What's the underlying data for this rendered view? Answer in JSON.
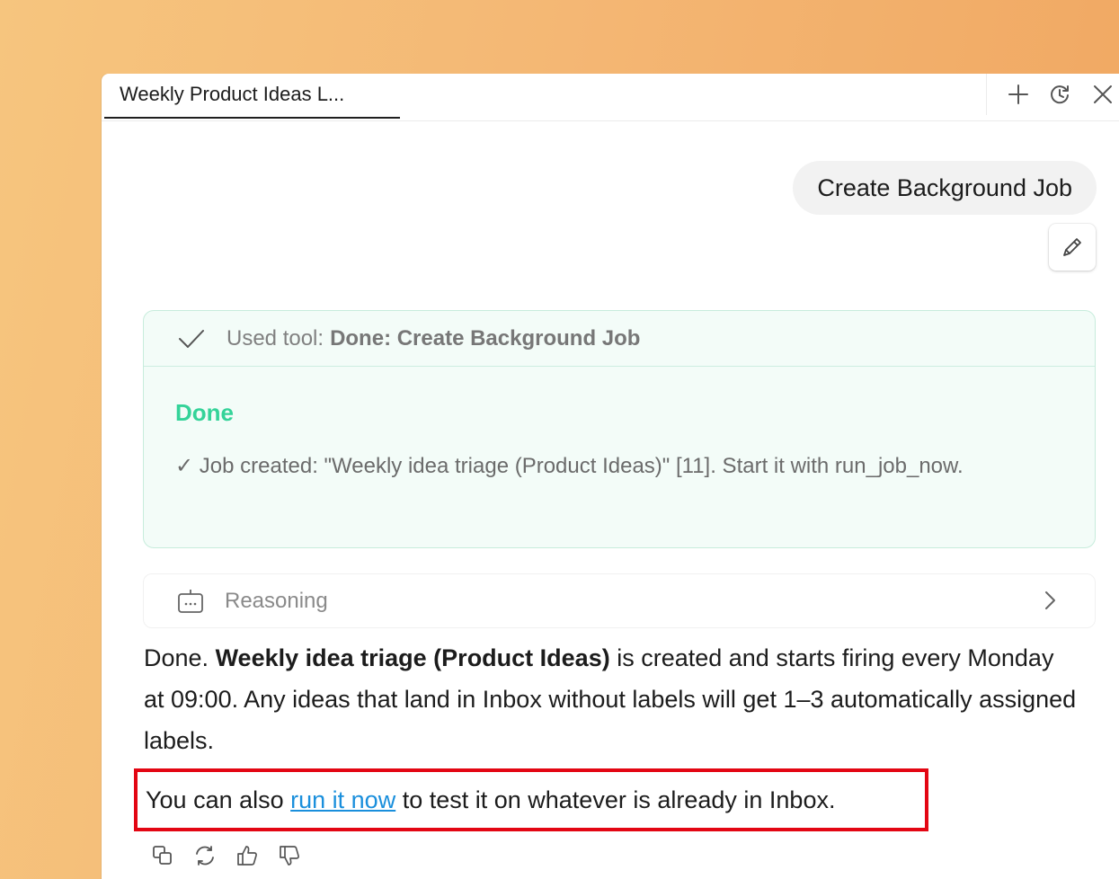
{
  "tab": {
    "title": "Weekly Product Ideas L..."
  },
  "tab_actions": {
    "icons": [
      "plus-icon",
      "history-icon",
      "close-icon"
    ]
  },
  "user_message": {
    "text": "Create Background Job"
  },
  "tool_call": {
    "prefix": "Used tool:",
    "name": "Done: Create Background Job",
    "status": "Done",
    "result": "✓ Job created: \"Weekly idea triage (Product Ideas)\" [11]. Start it with run_job_now."
  },
  "reasoning": {
    "label": "Reasoning"
  },
  "answer": {
    "p1_start": "Done. ",
    "p1_bold": "Weekly idea triage (Product Ideas)",
    "p1_end": " is created and starts firing every Monday at 09:00. Any ideas that land in Inbox without labels will get 1–3 automatically assigned labels.",
    "p2_start": "You can also ",
    "p2_link": "run it now",
    "p2_end": " to test it on whatever is already in Inbox."
  },
  "message_actions": [
    "copy-icon",
    "regenerate-icon",
    "thumbs-up-icon",
    "thumbs-down-icon"
  ],
  "colors": {
    "accent_green": "#34d399",
    "link_blue": "#1a8fdc",
    "highlight_red": "#e30613",
    "card_bg": "#f3fcf8"
  }
}
